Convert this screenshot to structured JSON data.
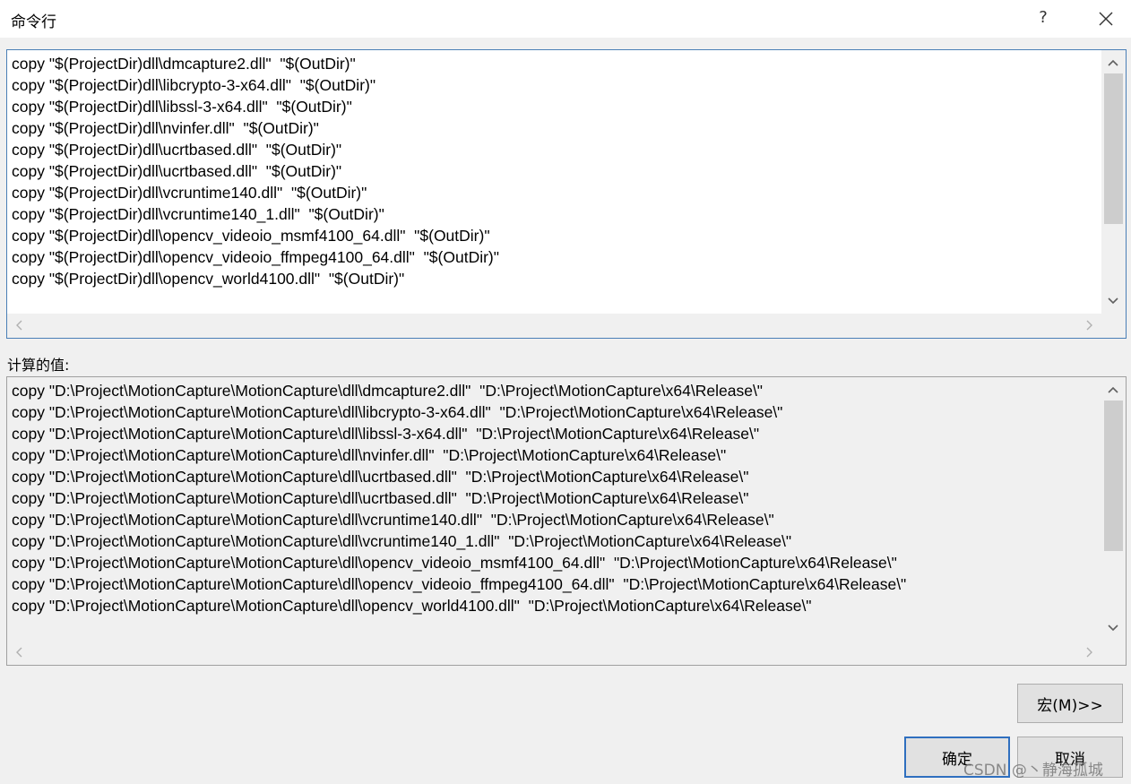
{
  "window": {
    "title": "命令行",
    "help_label": "?"
  },
  "command_lines": [
    "copy \"$(ProjectDir)dll\\dmcapture2.dll\"  \"$(OutDir)\"",
    "copy \"$(ProjectDir)dll\\libcrypto-3-x64.dll\"  \"$(OutDir)\"",
    "copy \"$(ProjectDir)dll\\libssl-3-x64.dll\"  \"$(OutDir)\"",
    "copy \"$(ProjectDir)dll\\nvinfer.dll\"  \"$(OutDir)\"",
    "copy \"$(ProjectDir)dll\\ucrtbased.dll\"  \"$(OutDir)\"",
    "copy \"$(ProjectDir)dll\\ucrtbased.dll\"  \"$(OutDir)\"",
    "copy \"$(ProjectDir)dll\\vcruntime140.dll\"  \"$(OutDir)\"",
    "copy \"$(ProjectDir)dll\\vcruntime140_1.dll\"  \"$(OutDir)\"",
    "copy \"$(ProjectDir)dll\\opencv_videoio_msmf4100_64.dll\"  \"$(OutDir)\"",
    "copy \"$(ProjectDir)dll\\opencv_videoio_ffmpeg4100_64.dll\"  \"$(OutDir)\"",
    "copy \"$(ProjectDir)dll\\opencv_world4100.dll\"  \"$(OutDir)\""
  ],
  "evaluated": {
    "label": "计算的值:",
    "lines": [
      "copy \"D:\\Project\\MotionCapture\\MotionCapture\\dll\\dmcapture2.dll\"  \"D:\\Project\\MotionCapture\\x64\\Release\\\"",
      "copy \"D:\\Project\\MotionCapture\\MotionCapture\\dll\\libcrypto-3-x64.dll\"  \"D:\\Project\\MotionCapture\\x64\\Release\\\"",
      "copy \"D:\\Project\\MotionCapture\\MotionCapture\\dll\\libssl-3-x64.dll\"  \"D:\\Project\\MotionCapture\\x64\\Release\\\"",
      "copy \"D:\\Project\\MotionCapture\\MotionCapture\\dll\\nvinfer.dll\"  \"D:\\Project\\MotionCapture\\x64\\Release\\\"",
      "copy \"D:\\Project\\MotionCapture\\MotionCapture\\dll\\ucrtbased.dll\"  \"D:\\Project\\MotionCapture\\x64\\Release\\\"",
      "copy \"D:\\Project\\MotionCapture\\MotionCapture\\dll\\ucrtbased.dll\"  \"D:\\Project\\MotionCapture\\x64\\Release\\\"",
      "copy \"D:\\Project\\MotionCapture\\MotionCapture\\dll\\vcruntime140.dll\"  \"D:\\Project\\MotionCapture\\x64\\Release\\\"",
      "copy \"D:\\Project\\MotionCapture\\MotionCapture\\dll\\vcruntime140_1.dll\"  \"D:\\Project\\MotionCapture\\x64\\Release\\\"",
      "copy \"D:\\Project\\MotionCapture\\MotionCapture\\dll\\opencv_videoio_msmf4100_64.dll\"  \"D:\\Project\\MotionCapture\\x64\\Release\\\"",
      "copy \"D:\\Project\\MotionCapture\\MotionCapture\\dll\\opencv_videoio_ffmpeg4100_64.dll\"  \"D:\\Project\\MotionCapture\\x64\\Release\\\"",
      "copy \"D:\\Project\\MotionCapture\\MotionCapture\\dll\\opencv_world4100.dll\"  \"D:\\Project\\MotionCapture\\x64\\Release\\\""
    ]
  },
  "buttons": {
    "macros_label": "宏(M)>>",
    "ok_label": "确定",
    "cancel_label": "取消"
  },
  "watermark": "CSDN @丶静海孤城",
  "scroll": {
    "command_vertical_thumb_fraction": [
      0.09,
      0.66
    ],
    "evaluated_vertical_thumb_fraction": [
      0.09,
      0.66
    ]
  }
}
